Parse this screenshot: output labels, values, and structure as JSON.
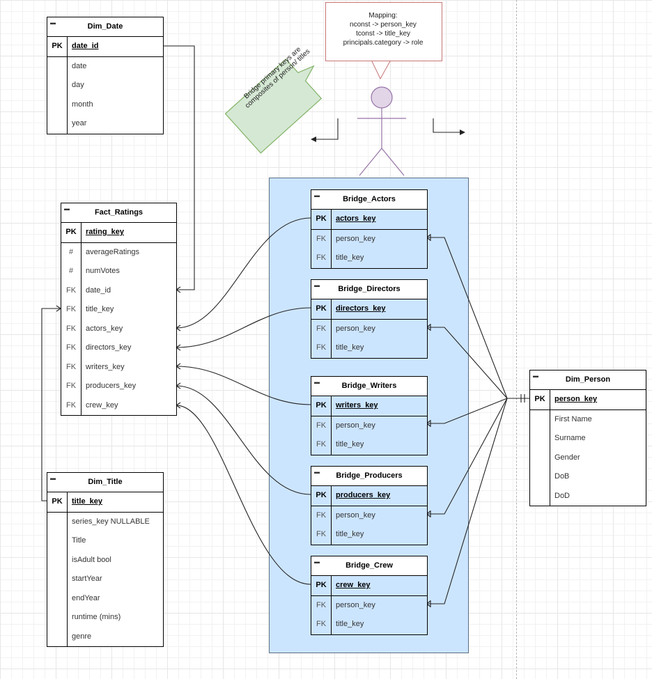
{
  "tables": {
    "dim_date": {
      "title": "Dim_Date",
      "pk": {
        "key": "PK",
        "field": "date_id"
      },
      "fields": [
        {
          "key": "",
          "field": "date"
        },
        {
          "key": "",
          "field": "day"
        },
        {
          "key": "",
          "field": "month"
        },
        {
          "key": "",
          "field": "year"
        }
      ]
    },
    "fact_ratings": {
      "title": "Fact_Ratings",
      "pk": {
        "key": "PK",
        "field": "rating_key"
      },
      "fields": [
        {
          "key": "#",
          "field": "averageRatings"
        },
        {
          "key": "#",
          "field": "numVotes"
        },
        {
          "key": "FK",
          "field": "date_id"
        },
        {
          "key": "FK",
          "field": "title_key"
        },
        {
          "key": "FK",
          "field": "actors_key"
        },
        {
          "key": "FK",
          "field": "directors_key"
        },
        {
          "key": "FK",
          "field": "writers_key"
        },
        {
          "key": "FK",
          "field": "producers_key"
        },
        {
          "key": "FK",
          "field": "crew_key"
        }
      ]
    },
    "dim_title": {
      "title": "Dim_Title",
      "pk": {
        "key": "PK",
        "field": "title_key"
      },
      "fields": [
        {
          "key": "",
          "field": "series_key NULLABLE"
        },
        {
          "key": "",
          "field": "Title"
        },
        {
          "key": "",
          "field": "isAdult bool"
        },
        {
          "key": "",
          "field": "startYear"
        },
        {
          "key": "",
          "field": "endYear"
        },
        {
          "key": "",
          "field": "runtime (mins)"
        },
        {
          "key": "",
          "field": "genre"
        }
      ]
    },
    "bridge_actors": {
      "title": "Bridge_Actors",
      "pk": {
        "key": "PK",
        "field": "actors_key"
      },
      "fields": [
        {
          "key": "FK",
          "field": "person_key"
        },
        {
          "key": "FK",
          "field": "title_key"
        }
      ]
    },
    "bridge_directors": {
      "title": "Bridge_Directors",
      "pk": {
        "key": "PK",
        "field": "directors_key"
      },
      "fields": [
        {
          "key": "FK",
          "field": "person_key"
        },
        {
          "key": "FK",
          "field": "title_key"
        }
      ]
    },
    "bridge_writers": {
      "title": "Bridge_Writers",
      "pk": {
        "key": "PK",
        "field": "writers_key"
      },
      "fields": [
        {
          "key": "FK",
          "field": "person_key"
        },
        {
          "key": "FK",
          "field": "title_key"
        }
      ]
    },
    "bridge_producers": {
      "title": "Bridge_Producers",
      "pk": {
        "key": "PK",
        "field": "producers_key"
      },
      "fields": [
        {
          "key": "FK",
          "field": "person_key"
        },
        {
          "key": "FK",
          "field": "title_key"
        }
      ]
    },
    "bridge_crew": {
      "title": "Bridge_Crew",
      "pk": {
        "key": "PK",
        "field": "crew_key"
      },
      "fields": [
        {
          "key": "FK",
          "field": "person_key"
        },
        {
          "key": "FK",
          "field": "title_key"
        }
      ]
    },
    "dim_person": {
      "title": "Dim_Person",
      "pk": {
        "key": "PK",
        "field": "person_key"
      },
      "fields": [
        {
          "key": "",
          "field": "First Name"
        },
        {
          "key": "",
          "field": "Surname"
        },
        {
          "key": "",
          "field": "Gender"
        },
        {
          "key": "",
          "field": "DoB"
        },
        {
          "key": "",
          "field": "DoD"
        }
      ]
    }
  },
  "mapping_callout": {
    "lines": [
      "Mapping:",
      "nconst -> person_key",
      "tconst -> title_key",
      "principals.category -> role"
    ]
  },
  "bridge_note": {
    "text": "Bridge primary keys are composites of person/ titles"
  },
  "colors": {
    "bridge_group_fill": "#cce5ff",
    "callout_border": "#c77676",
    "note_fill": "#d5e8d4",
    "note_border": "#82b366",
    "actor_fill": "#e1d5e7",
    "actor_stroke": "#9673a6"
  },
  "icons": {
    "table_collapse": "minus-square-icon",
    "actor": "stick-figure-icon"
  }
}
